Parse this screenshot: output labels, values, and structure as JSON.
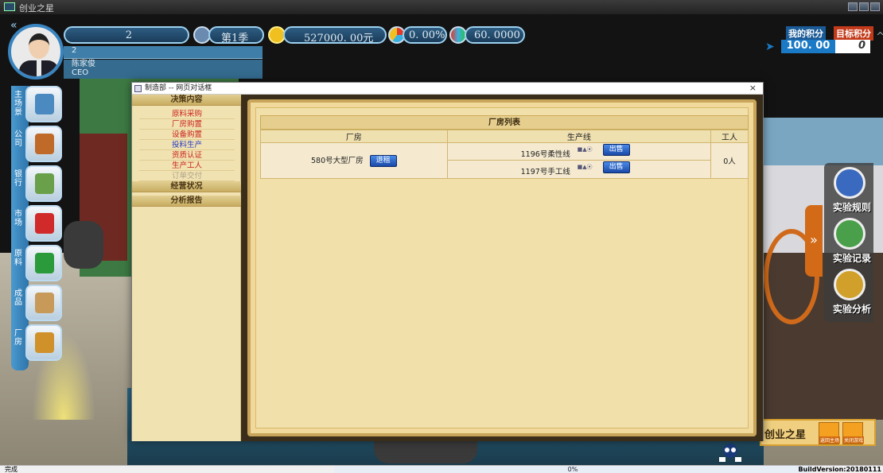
{
  "window": {
    "title": "创业之星"
  },
  "hud": {
    "player_number": "2",
    "quarter": "第1季",
    "cash": "527000. 00元",
    "market_share": "0. 00%",
    "score_metric": "60. 0000",
    "company_id": "2",
    "player_name": "陈家俊",
    "player_role": "CEO",
    "collapse_glyph": "«"
  },
  "score": {
    "my_label": "我的积分",
    "target_label": "目标积分",
    "my_value": "100. 00",
    "target_value": "0",
    "arrow_glyph": "➤",
    "caret_glyph": "^"
  },
  "left_menu": [
    {
      "label": "主场景",
      "icon": "buildings-icon",
      "color": "#4a8ac0"
    },
    {
      "label": "公司",
      "icon": "briefcase-icon",
      "color": "#c06a2a"
    },
    {
      "label": "银行",
      "icon": "money-icon",
      "color": "#6aa04a"
    },
    {
      "label": "市场",
      "icon": "shopping-cart-icon",
      "color": "#d02a2a"
    },
    {
      "label": "原料",
      "icon": "barrels-icon",
      "color": "#2a9a3a"
    },
    {
      "label": "成品",
      "icon": "box-icon",
      "color": "#c89a5a"
    },
    {
      "label": "厂房",
      "icon": "toolbox-icon",
      "color": "#d0902a"
    }
  ],
  "right_menu": {
    "tab_glyph": "»",
    "items": [
      {
        "label": "实验规则",
        "icon": "rules-icon",
        "color": "#3a6ac0"
      },
      {
        "label": "实验记录",
        "icon": "clipboard-icon",
        "color": "#4aa04a"
      },
      {
        "label": "实验分析",
        "icon": "pie-chart-icon",
        "color": "#d0a02a"
      }
    ]
  },
  "brand": {
    "name": "创业之星",
    "home_label": "返回主场",
    "exit_label": "关闭游戏"
  },
  "statusbar": {
    "left": "完成",
    "progress": "0%",
    "build": "BuildVersion:20180111"
  },
  "dialog": {
    "title": "制造部 -- 网页对话框",
    "close": "×",
    "nav": {
      "section1": "决策内容",
      "items": [
        {
          "label": "原料采购",
          "state": "red"
        },
        {
          "label": "厂房购置",
          "state": "red"
        },
        {
          "label": "设备购置",
          "state": "red"
        },
        {
          "label": "投料生产",
          "state": "blue"
        },
        {
          "label": "资质认证",
          "state": "red"
        },
        {
          "label": "生产工人",
          "state": "red"
        },
        {
          "label": "订单交付",
          "state": "gray"
        }
      ],
      "section2": "经营状况",
      "section3": "分析报告"
    },
    "factory_list": {
      "title": "厂房列表",
      "headers": [
        "厂房",
        "生产线",
        "工人"
      ],
      "rows": [
        {
          "factory": "580号大型厂房",
          "action": "退租",
          "workers": "0人",
          "lines": [
            {
              "name": "1196号柔性线",
              "marks": "■▲⦿",
              "action": "出售"
            },
            {
              "name": "1197号手工线",
              "marks": "■▲⦿",
              "action": "出售"
            }
          ]
        }
      ]
    }
  }
}
